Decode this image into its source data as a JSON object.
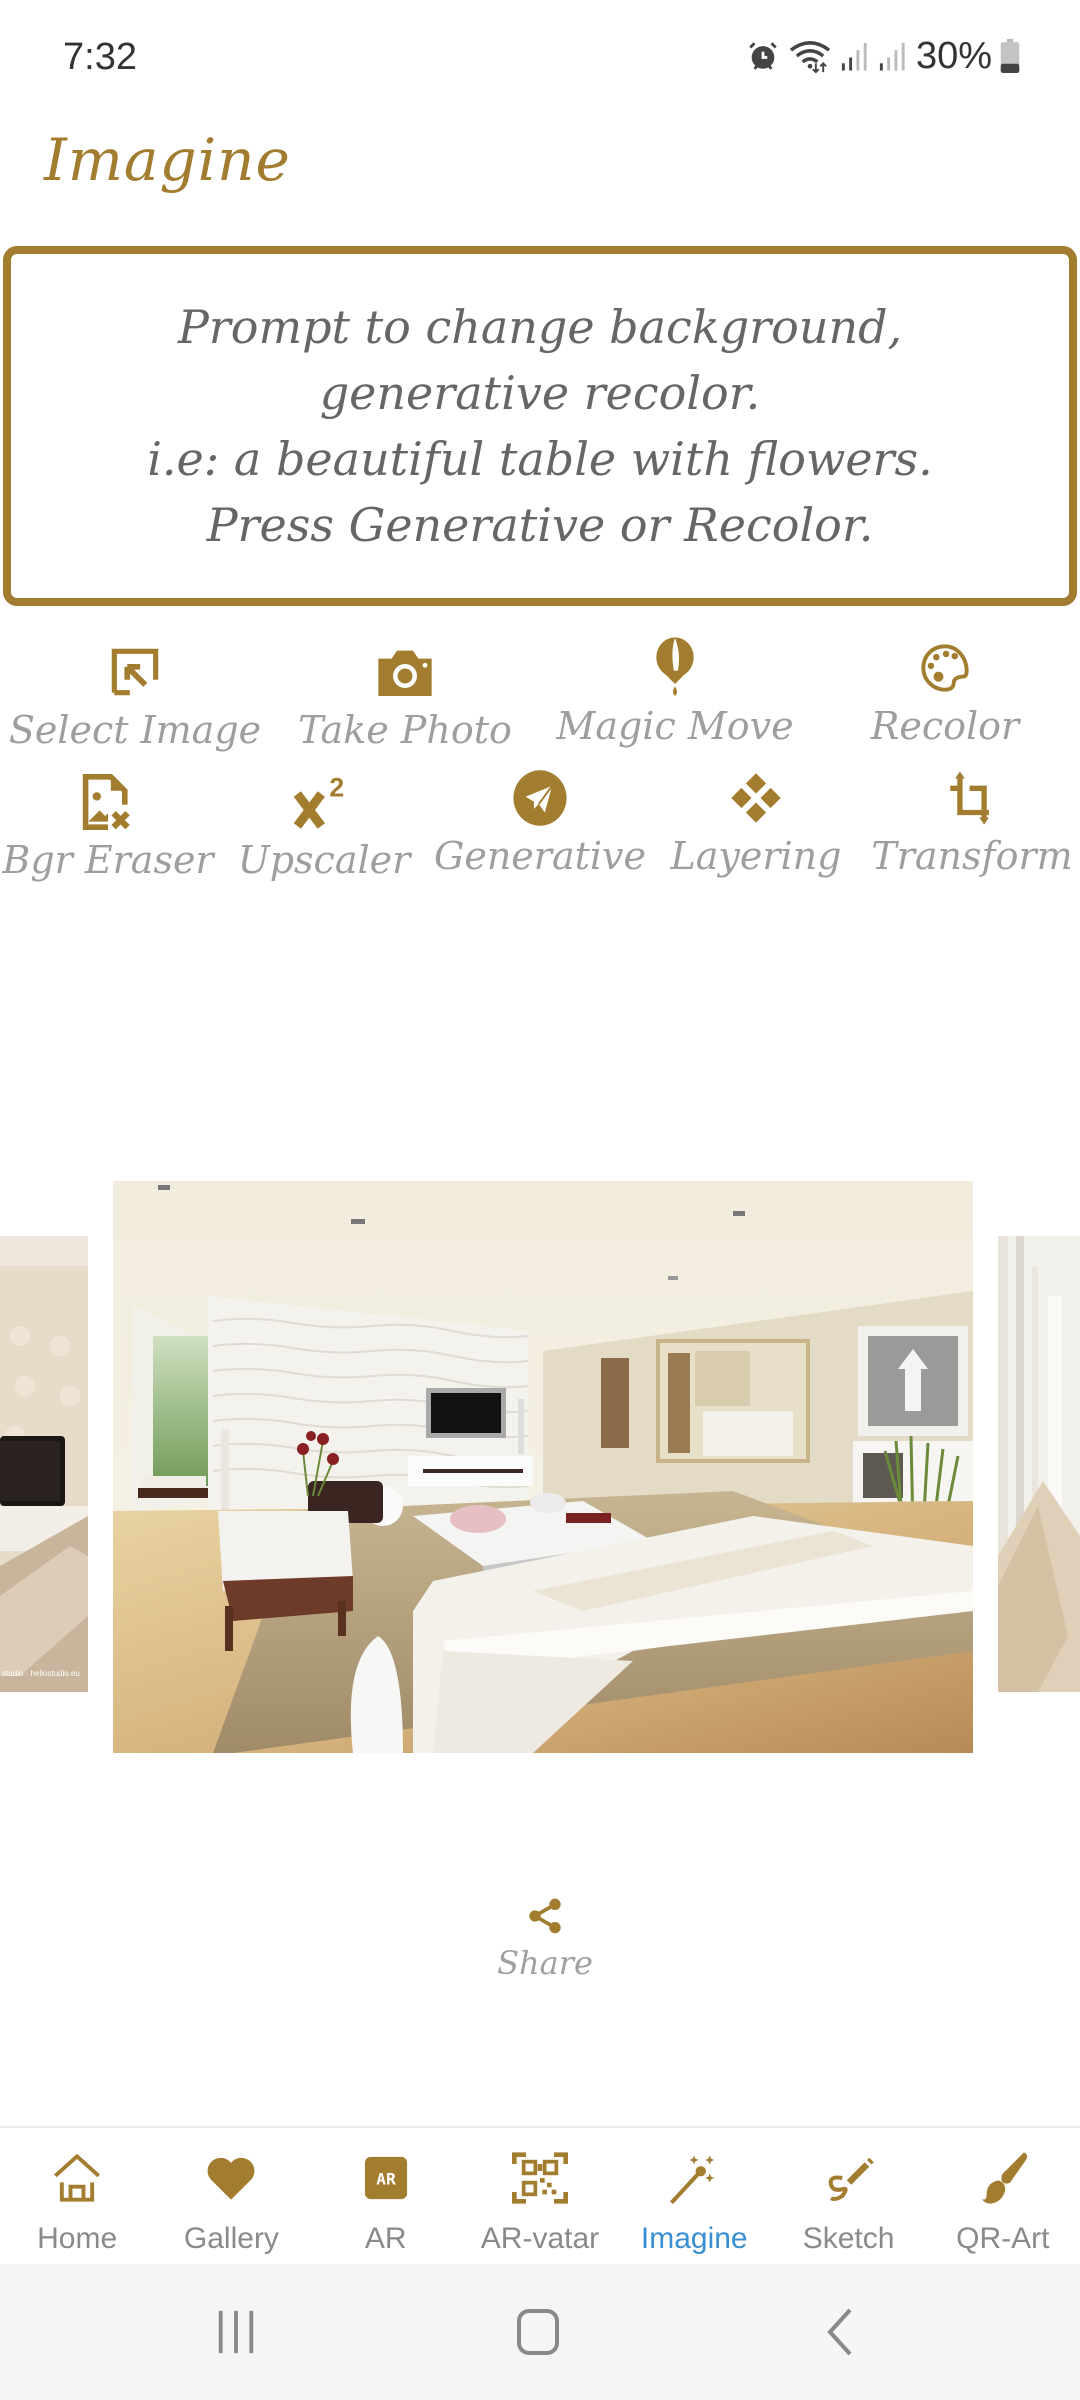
{
  "status_bar": {
    "time": "7:32",
    "battery_percent": "30%",
    "battery_level": 0.3,
    "icons": [
      "alarm-icon",
      "wifi-icon",
      "signal-icon",
      "signal-icon",
      "battery-icon"
    ]
  },
  "header": {
    "title": "Imagine"
  },
  "prompt": {
    "lines": [
      "Prompt to change background, generative recolor.",
      "i.e: a beautiful table with flowers.",
      "Press Generative or Recolor."
    ]
  },
  "tools": [
    {
      "label": "Select Image",
      "icon": "select-image-icon"
    },
    {
      "label": "Take Photo",
      "icon": "camera-icon"
    },
    {
      "label": "Magic Move",
      "icon": "balloon-icon"
    },
    {
      "label": "Recolor",
      "icon": "palette-icon"
    },
    {
      "label": "Bgr Eraser",
      "icon": "image-remove-icon"
    },
    {
      "label": "Upscaler",
      "icon": "superscript-icon"
    },
    {
      "label": "Generative",
      "icon": "send-icon"
    },
    {
      "label": "Layering",
      "icon": "diamonds-icon"
    },
    {
      "label": "Transform",
      "icon": "crop-icon"
    }
  ],
  "carousel": {
    "images": [
      {
        "description": "Beige living room with TV and peacock-pattern wallpaper",
        "watermark": "studio · hellostudio.eu"
      },
      {
        "description": "Bright modern living room with white sofas, wave-textured wall, TV and flowers"
      },
      {
        "description": "Room with white curtains and beige armchair"
      }
    ]
  },
  "share": {
    "label": "Share"
  },
  "bottom_nav": {
    "items": [
      {
        "label": "Home",
        "icon": "home-icon"
      },
      {
        "label": "Gallery",
        "icon": "heart-icon"
      },
      {
        "label": "AR",
        "icon": "ar-icon"
      },
      {
        "label": "AR-vatar",
        "icon": "qr-scan-icon"
      },
      {
        "label": "Imagine",
        "icon": "magic-wand-icon",
        "active": true
      },
      {
        "label": "Sketch",
        "icon": "sketch-icon"
      },
      {
        "label": "QR-Art",
        "icon": "brush-icon"
      }
    ]
  },
  "colors": {
    "accent": "#a37d2f",
    "active_tab": "#3a8fd0",
    "label_gray": "#9e9e9e",
    "prompt_text": "#666666"
  }
}
